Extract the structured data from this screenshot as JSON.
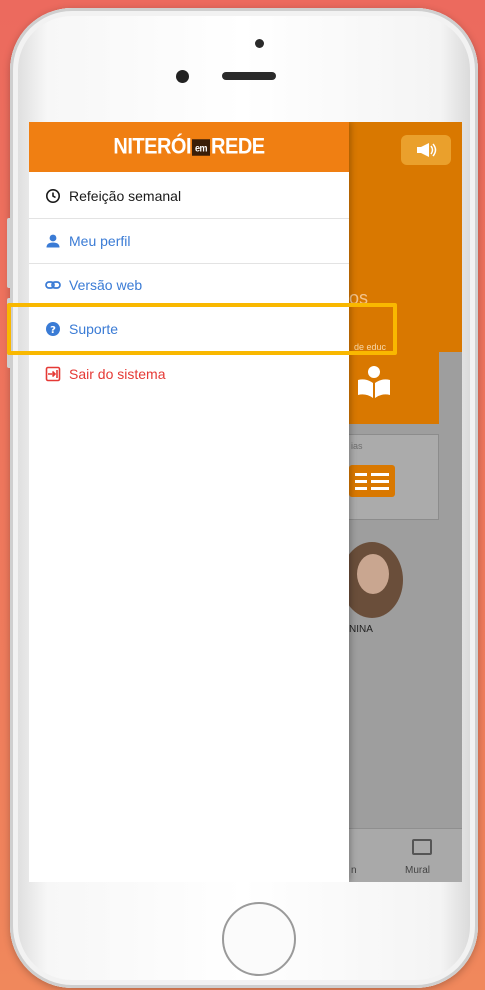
{
  "app": {
    "logo_left": "NITERÓI",
    "logo_mid": "em",
    "logo_right": "REDE"
  },
  "menu": {
    "items": [
      {
        "label": "Refeição semanal",
        "icon": "clock-icon",
        "color": "#1a1a1a"
      },
      {
        "label": "Meu perfil",
        "icon": "person-icon",
        "color": "#3a7bd5"
      },
      {
        "label": "Versão web",
        "icon": "link-icon",
        "color": "#3a7bd5"
      },
      {
        "label": "Suporte",
        "icon": "help-circle-icon",
        "color": "#3a7bd5"
      },
      {
        "label": "Sair do sistema",
        "icon": "logout-icon",
        "color": "#e53935"
      }
    ]
  },
  "background": {
    "header_text": "os",
    "card1_label": "de educ",
    "card2_label": "ias",
    "avatar_name": "NINA",
    "bottom_nav": {
      "left_label": "n",
      "mural_label": "Mural"
    }
  },
  "colors": {
    "accent": "#f07f12",
    "highlight": "#f9b800",
    "link": "#3a7bd5",
    "danger": "#e53935"
  }
}
